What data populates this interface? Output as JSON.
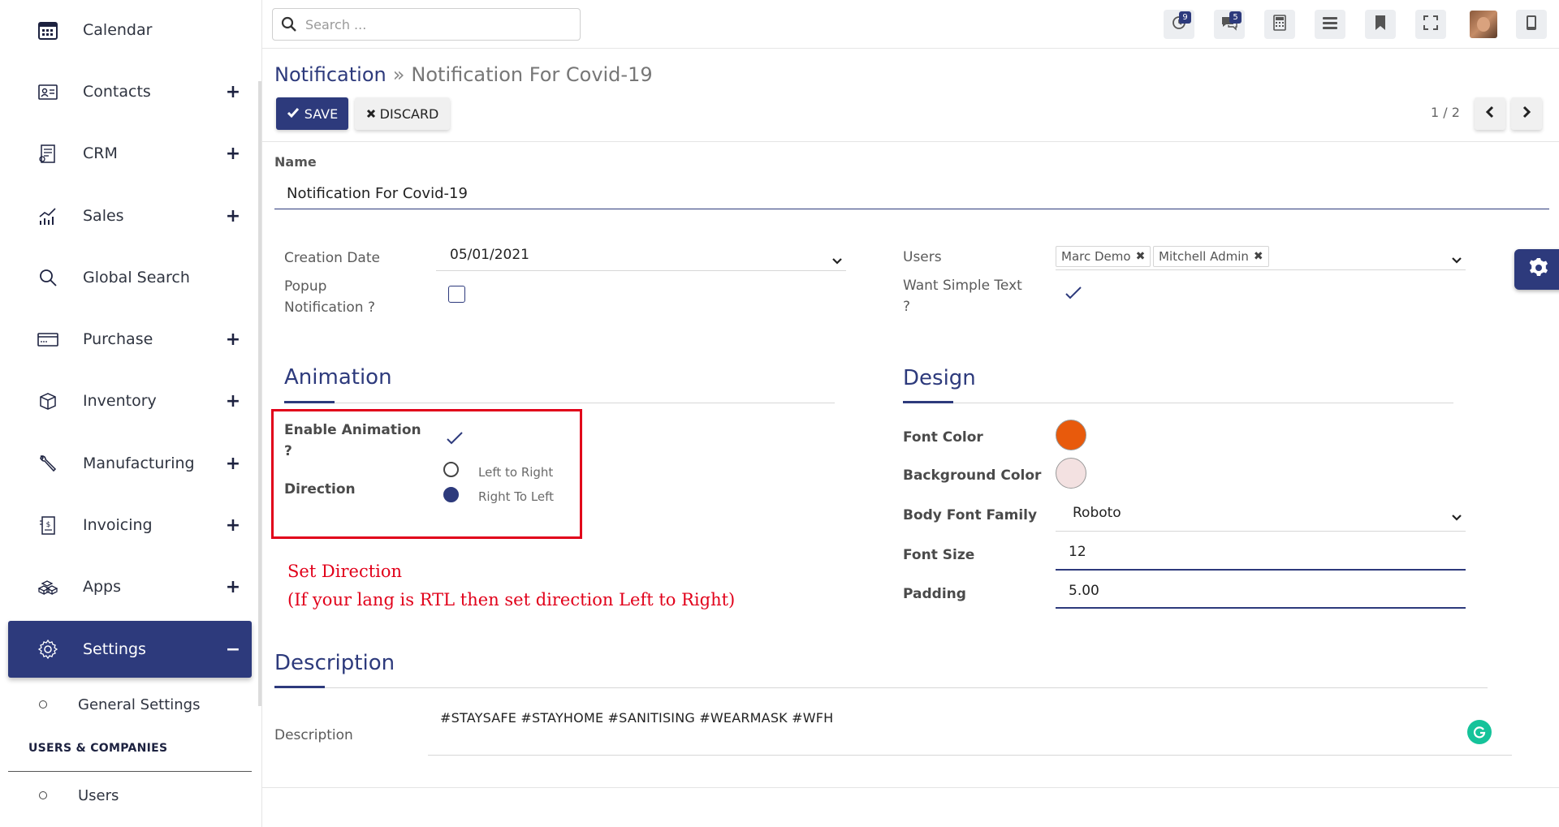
{
  "sidebar": {
    "items": [
      {
        "label": "Calendar",
        "icon": "calendar-icon"
      },
      {
        "label": "Contacts",
        "icon": "contacts-icon",
        "expand": "+"
      },
      {
        "label": "CRM",
        "icon": "crm-icon",
        "expand": "+"
      },
      {
        "label": "Sales",
        "icon": "sales-chart-icon",
        "expand": "+"
      },
      {
        "label": "Global Search",
        "icon": "search-icon"
      },
      {
        "label": "Purchase",
        "icon": "credit-card-icon",
        "expand": "+"
      },
      {
        "label": "Inventory",
        "icon": "box-icon",
        "expand": "+"
      },
      {
        "label": "Manufacturing",
        "icon": "wrench-icon",
        "expand": "+"
      },
      {
        "label": "Invoicing",
        "icon": "invoice-icon",
        "expand": "+"
      },
      {
        "label": "Apps",
        "icon": "apps-icon",
        "expand": "+"
      },
      {
        "label": "Settings",
        "icon": "gear-icon",
        "expand": "−"
      }
    ],
    "sub_general": "General Settings",
    "section_users": "USERS & COMPANIES",
    "sub_users": "Users"
  },
  "topbar": {
    "search_placeholder": "Search ...",
    "activity_badge": "9",
    "messages_badge": "5"
  },
  "breadcrumb": {
    "parent": "Notification",
    "separator": "»",
    "current": "Notification For Covid-19"
  },
  "actions": {
    "save": "SAVE",
    "discard": "DISCARD"
  },
  "pager": {
    "text": "1 / 2"
  },
  "form": {
    "name_label": "Name",
    "name_value": "Notification For Covid-19",
    "creation_date_label": "Creation Date",
    "creation_date_value": "05/01/2021",
    "popup_label_1": "Popup",
    "popup_label_2": "Notification ?",
    "users_label": "Users",
    "users_tags": [
      "Marc Demo",
      "Mitchell Admin"
    ],
    "simple_text_label_1": "Want Simple Text",
    "simple_text_label_2": "?"
  },
  "animation": {
    "title": "Animation",
    "enable_label_1": "Enable Animation",
    "enable_label_2": "?",
    "direction_label": "Direction",
    "option_ltr": "Left to Right",
    "option_rtl": "Right To Left",
    "selected": "Right To Left"
  },
  "note": {
    "line1": "Set Direction",
    "line2": "(If your lang is RTL then set direction Left to Right)"
  },
  "design": {
    "title": "Design",
    "font_color_label": "Font Color",
    "font_color": "#E85A0C",
    "bg_color_label": "Background Color",
    "bg_color": "#F3E1E1",
    "font_family_label": "Body Font Family",
    "font_family_value": "Roboto",
    "font_size_label": "Font Size",
    "font_size_value": "12",
    "padding_label": "Padding",
    "padding_value": "5.00"
  },
  "description": {
    "title": "Description",
    "label": "Description",
    "text": "#STAYSAFE  #STAYHOME  #SANITISING  #WEARMASK  #WFH"
  },
  "colors": {
    "brand": "#2D3A7C",
    "annotation_red": "#E1001A"
  }
}
